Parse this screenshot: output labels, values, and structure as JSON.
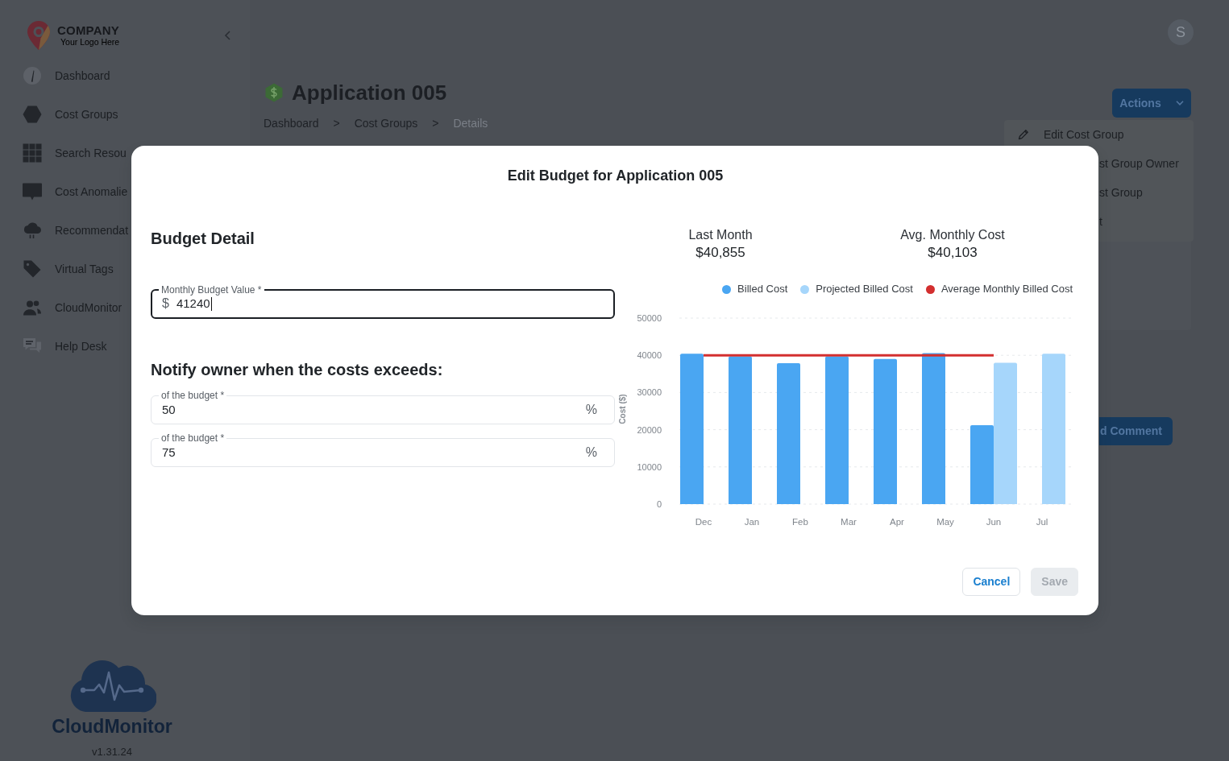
{
  "sidebar": {
    "logo": {
      "name": "COMPANY",
      "tagline": "Your Logo Here"
    },
    "items": [
      {
        "label": "Dashboard"
      },
      {
        "label": "Cost Groups"
      },
      {
        "label": "Search Resou"
      },
      {
        "label": "Cost Anomalie"
      },
      {
        "label": "Recommendat"
      },
      {
        "label": "Virtual Tags"
      },
      {
        "label": "CloudMonitor"
      },
      {
        "label": "Help Desk"
      }
    ],
    "footer": {
      "product": "CloudMonitor",
      "version": "v1.31.24"
    }
  },
  "topbar": {
    "avatar": "S"
  },
  "header": {
    "title": "Application 005",
    "breadcrumb": [
      {
        "kind": "link",
        "label": "Dashboard"
      },
      {
        "kind": "separator",
        "label": ">"
      },
      {
        "kind": "link",
        "label": "Cost Groups"
      },
      {
        "kind": "separator",
        "label": ">"
      },
      {
        "kind": "current",
        "label": "Details"
      }
    ]
  },
  "actions": {
    "label": "Actions",
    "expanded": true,
    "menu": [
      {
        "kind": "full",
        "label": "Edit Cost Group"
      },
      {
        "kind": "covered",
        "label": "st Group Owner"
      },
      {
        "kind": "covered",
        "label": "st Group"
      },
      {
        "kind": "covered",
        "label": "t"
      }
    ]
  },
  "comment_button": {
    "label": "d Comment"
  },
  "modal": {
    "title": "Edit Budget for Application 005",
    "budget": {
      "heading": "Budget Detail",
      "field": {
        "label": "Monthly Budget Value *",
        "prefix": "$",
        "value": "41240",
        "focused": true
      }
    },
    "notify": {
      "heading": "Notify owner when the costs exceeds:",
      "fields": [
        {
          "label": "of the budget *",
          "value": "50",
          "suffix": "%",
          "focused": false
        },
        {
          "label": "of the budget *",
          "value": "75",
          "suffix": "%",
          "focused": false
        }
      ]
    },
    "stats": [
      {
        "label": "Last Month",
        "value": "$40,855"
      },
      {
        "label": "Avg. Monthly Cost",
        "value": "$40,103"
      }
    ],
    "chart_data": {
      "type": "bar",
      "ylabel": "Cost ($)",
      "categories": [
        "Dec",
        "Jan",
        "Feb",
        "Mar",
        "Apr",
        "May",
        "Jun",
        "Jul"
      ],
      "series": [
        {
          "name": "Billed Cost",
          "color": "#4aa6f2",
          "values": [
            40400,
            39700,
            37900,
            39700,
            39000,
            40600,
            21200,
            null
          ]
        },
        {
          "name": "Projected Billed Cost",
          "color": "#a6d6fb",
          "values": [
            null,
            null,
            null,
            null,
            null,
            null,
            38000,
            40400
          ]
        },
        {
          "name": "Average Monthly Billed Cost",
          "color": "#d32f2f",
          "type": "line",
          "values": [
            40000,
            40000,
            40000,
            40000,
            40000,
            40000,
            40000,
            null
          ]
        }
      ],
      "ylim": [
        0,
        50000
      ],
      "yticks": [
        0,
        10000,
        20000,
        30000,
        40000,
        50000
      ],
      "grid": true
    },
    "buttons": [
      {
        "kind": "outline",
        "label": "Cancel",
        "disabled": false
      },
      {
        "kind": "primary",
        "label": "Save",
        "disabled": true
      }
    ]
  }
}
